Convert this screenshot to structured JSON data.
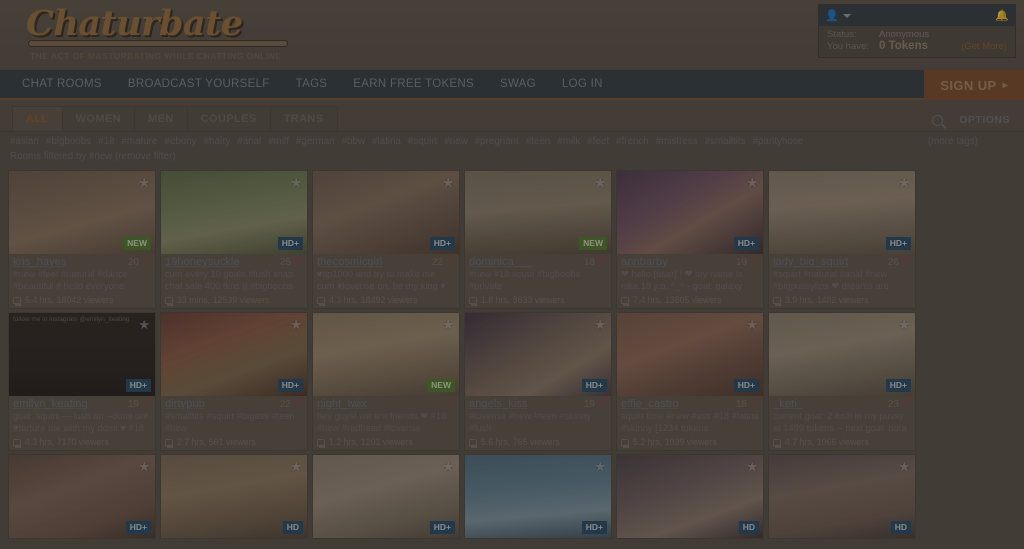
{
  "brand": {
    "logo": "Chaturbate",
    "tagline": "THE ACT OF MASTURBATING WHILE CHATTING ONLINE"
  },
  "userbox": {
    "status_label": "Status:",
    "status_value": "Anonymous",
    "tokens_label": "You have:",
    "tokens_value": "0 Tokens",
    "get_more": "(Get More)"
  },
  "nav": {
    "items": [
      {
        "label": "CHAT ROOMS"
      },
      {
        "label": "BROADCAST YOURSELF"
      },
      {
        "label": "TAGS"
      },
      {
        "label": "EARN FREE TOKENS"
      },
      {
        "label": "SWAG"
      },
      {
        "label": "LOG IN"
      }
    ],
    "signup": "SIGN UP",
    "signup_chevron": "▸"
  },
  "gender_tabs": [
    {
      "label": "ALL",
      "active": true
    },
    {
      "label": "WOMEN",
      "active": false
    },
    {
      "label": "MEN",
      "active": false
    },
    {
      "label": "COUPLES",
      "active": false
    },
    {
      "label": "TRANS",
      "active": false
    }
  ],
  "tools": {
    "options": "OPTIONS"
  },
  "tags": [
    "#asian",
    "#bigboobs",
    "#18",
    "#mature",
    "#ebony",
    "#hairy",
    "#anal",
    "#milf",
    "#german",
    "#bbw",
    "#latina",
    "#squirt",
    "#new",
    "#pregnant",
    "#teen",
    "#milk",
    "#feet",
    "#french",
    "#mistress",
    "#smalltits",
    "#pantyhose"
  ],
  "more_tags": "(more tags)",
  "filter_line": "Rooms filtered by #new (remove filter)",
  "colors": {
    "accent_orange": "#97552d",
    "nav_bg": "#2c3c44",
    "badge_hd": "#1f4a6b",
    "badge_new": "#4e7a2e"
  },
  "rooms": [
    {
      "username": "kris_hayes",
      "age": "20",
      "badge": "NEW",
      "badge_type": "new",
      "subject": "#new #feet #natural #dance #beautiful # hello everyone",
      "meta": "5.4 hrs, 18042 viewers",
      "img": "linear-gradient(165deg,#6b5a4e 0%,#7d6a58 35%,#8a7560 60%,#5d4f44 100%)"
    },
    {
      "username": "19honeysuckle",
      "age": "25",
      "badge": "HD+",
      "badge_type": "hd",
      "subject": "cum every 10 goals #lush snap chat sale 400 tkns || #bigboobs",
      "meta": "33 mins, 12539 viewers",
      "img": "linear-gradient(170deg,#5c6a4a 0%,#76855e 40%,#8b8f6c 65%,#4f5940 100%)"
    },
    {
      "username": "thecosmicgirl",
      "age": "22",
      "badge": "HD+",
      "badge_type": "hd",
      "subject": "♥tip1000 and try to make me cum ♥lovense on, be my king ♥",
      "meta": "4.3 hrs, 18492 viewers",
      "img": "linear-gradient(160deg,#6d5b52 0%,#85705f 40%,#6a584c 70%,#4e4038 100%)"
    },
    {
      "username": "dominica___",
      "age": "18",
      "badge": "NEW",
      "badge_type": "new",
      "subject": "#new #18 #cute #bigboobs #private",
      "meta": "1.8 hrs, 8633 viewers",
      "img": "linear-gradient(175deg,#7e7464 0%,#8d8370 45%,#6e6354 75%,#554c40 100%)"
    },
    {
      "username": "annbarby",
      "age": "19",
      "badge": "HD+",
      "badge_type": "hd",
      "subject": "❤ hello [user] ! ❤ my name is nika,19 y.o. ^_^ - goal: galaxy",
      "meta": "7.4 hrs, 13605 viewers",
      "img": "linear-gradient(150deg,#4a3a52 0%,#6d5166 35%,#8a6b62 60%,#3a2e38 100%)"
    },
    {
      "username": "lady_big_squirt",
      "age": "26",
      "badge": "HD+",
      "badge_type": "hd",
      "subject": "#squirt #natural #anal #new #bigpussylips ❤ dreams are",
      "meta": "3.9 hrs, 1482 viewers",
      "img": "linear-gradient(175deg,#8a7f70 0%,#9a8c79 40%,#7d7263 70%,#5f564a 100%)"
    },
    {
      "username": "emilyn_keating",
      "age": "19",
      "badge": "HD+",
      "badge_type": "hd",
      "subject": "goal: squirt ----lush on --domi on! ♥torture me with my domi ♥ #18",
      "meta": "4.3 hrs, 7170 viewers",
      "img": "linear-gradient(180deg,#2a2522 0%,#242020 60%,#1d1a18 100%)",
      "overlay_text": "follow me in instagram @emilyn_keating"
    },
    {
      "username": "dirtypub",
      "age": "22",
      "badge": "HD+",
      "badge_type": "hd",
      "subject": "#smalltits #squirt #bigass #teen #new",
      "meta": "2.7 hrs, 561 viewers",
      "img": "linear-gradient(160deg,#6b3c36 0%,#8a5a46 35%,#7d6a4e 65%,#4a3228 100%)"
    },
    {
      "username": "night_twix",
      "age": "",
      "badge": "NEW",
      "badge_type": "new",
      "subject": "hey guys! we are friends ❤ #18 #new #redhead #lovense",
      "meta": "1.2 hrs, 1201 viewers",
      "img": "linear-gradient(170deg,#8a7b64 0%,#9d8c72 40%,#7e6f5a 70%,#5c5043 100%)"
    },
    {
      "username": "angels_kiss",
      "age": "19",
      "badge": "HD+",
      "badge_type": "hd",
      "subject": "#lovense #new #teen #skinny #lush",
      "meta": "5.6 hrs, 765 viewers",
      "img": "linear-gradient(150deg,#3d3346 0%,#6d5f58 40%,#8b7a68 70%,#463a4a 100%)"
    },
    {
      "username": "effie_castro",
      "age": "18",
      "badge": "HD+",
      "badge_type": "hd",
      "subject": "squirt time #new #ass #18 #latina #skinny [1234 tokens",
      "meta": "5.2 hrs, 1039 viewers",
      "img": "linear-gradient(160deg,#7a5a4e 0%,#8e6a58 40%,#6d4f44 70%,#4e3a32 100%)"
    },
    {
      "username": "_keti_",
      "age": "23",
      "badge": "HD+",
      "badge_type": "hd",
      "subject": "current goal: 2 lush in my pussy at 1499 tokens -- next goal: nora",
      "meta": "4.7 hrs, 1066 viewers",
      "img": "linear-gradient(170deg,#8a8070 0%,#9a8f7c 40%,#7a7062 70%,#5a5246 100%)"
    }
  ],
  "rooms_partial": [
    {
      "badge": "HD+",
      "badge_type": "hd",
      "img": "linear-gradient(160deg,#5e4a44 0%,#7d6558 40%,#6a5448 75%,#443630 100%)"
    },
    {
      "badge": "HD",
      "badge_type": "hd",
      "img": "linear-gradient(170deg,#7a6a56 0%,#8d7a62 40%,#6d5e4c 75%,#4e4438 100%)"
    },
    {
      "badge": "HD+",
      "badge_type": "hd",
      "img": "linear-gradient(165deg,#8a7f72 0%,#9a8e7e 40%,#786e60 75%,#574f45 100%)"
    },
    {
      "badge": "HD+",
      "badge_type": "hd",
      "img": "linear-gradient(175deg,#4a6d84 0%,#5e8296 40%,#7e9aa8 70%,#3c5668 100%)"
    },
    {
      "badge": "HD",
      "badge_type": "hd",
      "img": "linear-gradient(160deg,#4a4048 0%,#6d5f60 40%,#8a7a70 70%,#3a3236 100%)"
    },
    {
      "badge": "HD",
      "badge_type": "hd",
      "img": "linear-gradient(170deg,#5a4e50 0%,#7a6a62 40%,#6a5a52 75%,#443a38 100%)"
    }
  ]
}
